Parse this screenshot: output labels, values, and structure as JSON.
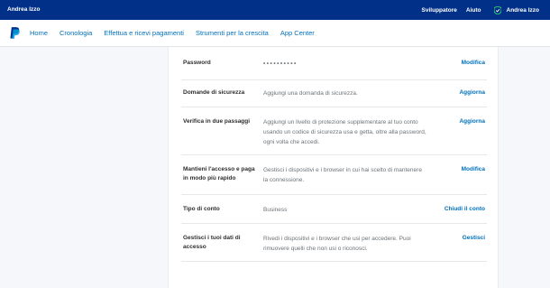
{
  "topbar": {
    "user_name_left": "Andrea Izzo",
    "developer": "Sviluppatore",
    "help": "Aiuto",
    "user_name_right": "Andrea Izzo"
  },
  "nav": {
    "items": [
      "Home",
      "Cronologia",
      "Effettua e ricevi pagamenti",
      "Strumenti per la crescita",
      "App Center"
    ]
  },
  "rows": [
    {
      "label": "Password",
      "value": "••••••••••",
      "action": "Modifica"
    },
    {
      "label": "Domande di sicurezza",
      "value": "Aggiungi una domanda di sicurezza.",
      "action": "Aggiorna"
    },
    {
      "label": "Verifica in due passaggi",
      "value_lines": [
        "Aggiungi un livello di protezione supplementare al tuo conto",
        "usando un codice di sicurezza usa e getta, oltre alla password,",
        "ogni volta che accedi."
      ],
      "action": "Aggiorna"
    },
    {
      "label_lines": [
        "Mantieni l'accesso e paga",
        "in modo più rapido"
      ],
      "value_lines": [
        "Gestisci i dispositivi e i browser in cui hai scelto di mantenere",
        "la connessione."
      ],
      "action": "Modifica"
    },
    {
      "label": "Tipo di conto",
      "value": "Business",
      "action": "Chiudi il conto"
    },
    {
      "label_lines": [
        "Gestisci i tuoi dati di",
        "accesso"
      ],
      "value_lines": [
        "Rivedi i dispositivi e i browser che usi per accedere. Puoi",
        "rimuovere quelli che non usi o riconosci."
      ],
      "action": "Gestisci"
    }
  ],
  "colors": {
    "topbar": "#003087",
    "link": "#0070ba",
    "shield": "#2dd36f"
  }
}
